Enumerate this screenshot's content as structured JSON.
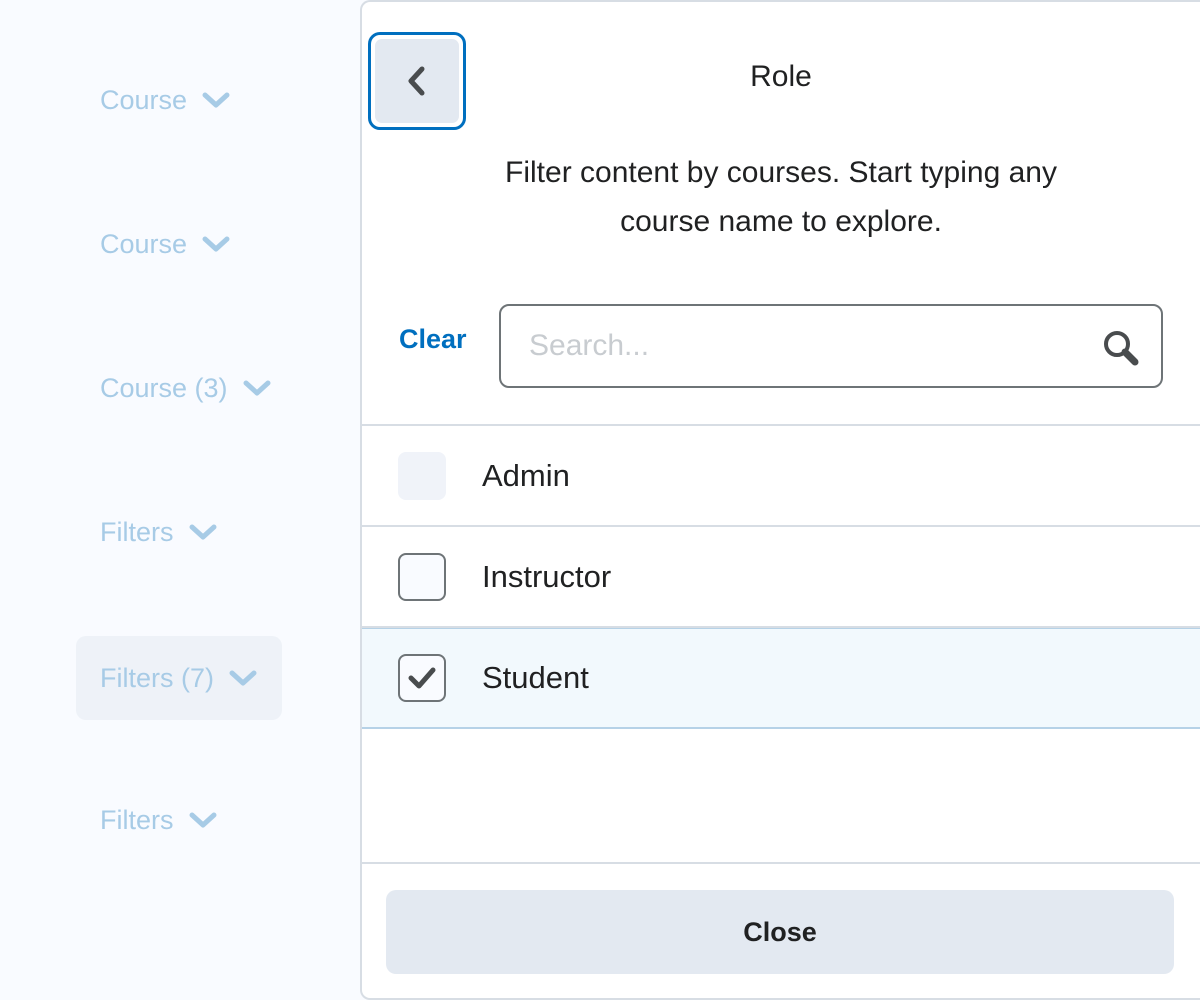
{
  "background": {
    "filters": [
      {
        "label": "Course",
        "active": false
      },
      {
        "label": "Course",
        "active": false
      },
      {
        "label": "Course (3)",
        "active": false
      },
      {
        "label": "Filters",
        "active": false
      },
      {
        "label": "Filters (7)",
        "active": true
      },
      {
        "label": "Filters",
        "active": false
      }
    ],
    "chevron_icon": "chevron-down-icon"
  },
  "dialog": {
    "back_icon": "chevron-left-icon",
    "title": "Role",
    "description": "Filter content by courses. Start typing any course name to explore.",
    "clear_label": "Clear",
    "search": {
      "placeholder": "Search...",
      "value": "",
      "icon": "search-icon"
    },
    "options": [
      {
        "label": "Admin",
        "state": "disabled"
      },
      {
        "label": "Instructor",
        "state": "unchecked"
      },
      {
        "label": "Student",
        "state": "checked"
      }
    ],
    "close_label": "Close"
  },
  "colors": {
    "accent": "#006fbf",
    "background_text": "#a7cbe6",
    "button_bg": "#e3e9f1",
    "selected_row": "#f2f9fd"
  }
}
